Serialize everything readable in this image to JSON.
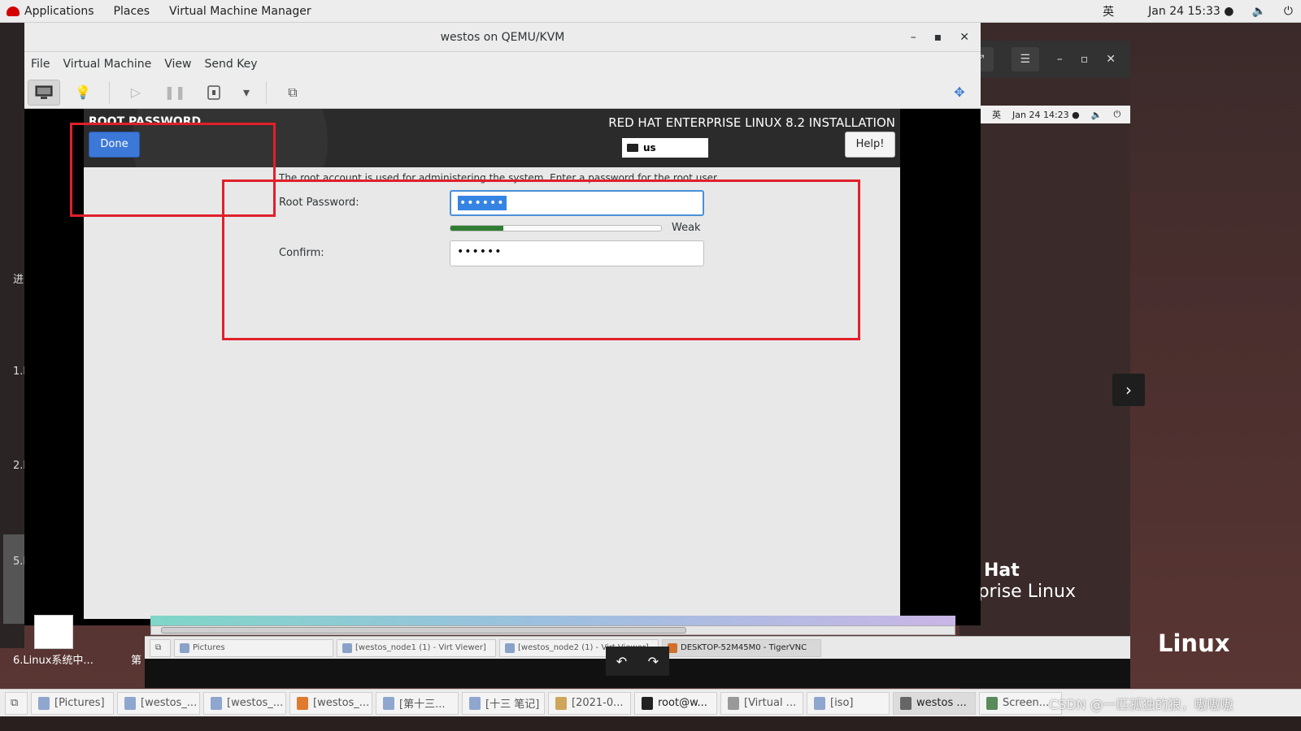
{
  "topbar": {
    "applications": "Applications",
    "places": "Places",
    "app_name": "Virtual Machine Manager",
    "input_method": "英",
    "datetime": "Jan 24  15:33 ●"
  },
  "vm_window": {
    "title": "westos on QEMU/KVM",
    "menu": [
      "File",
      "Virtual Machine",
      "View",
      "Send Key"
    ]
  },
  "installer": {
    "page_title": "ROOT PASSWORD",
    "done_label": "Done",
    "product_title": "RED HAT ENTERPRISE LINUX 8.2 INSTALLATION",
    "keyboard_layout": "us",
    "help_label": "Help!",
    "intro_text": "The root account is used for administering the system.  Enter a password for the root user.",
    "root_password_label": "Root Password:",
    "root_password_value": "••••••",
    "strength_label": "Weak",
    "strength_fraction": 0.25,
    "confirm_label": "Confirm:",
    "confirm_value": "••••••"
  },
  "annotation_color": "#e0202a",
  "background_window": {
    "inner_ime": "英",
    "inner_datetime": "Jan 24  14:23 ●",
    "logo_line1": "Hat",
    "logo_line2": "erprise Linux",
    "linux_text": "Linux"
  },
  "left_strip_labels": [
    "进",
    "1.l",
    "2.l",
    "5.l"
  ],
  "inner_taskbar": [
    "Pictures",
    "[westos_node1 (1) - Virt Viewer]",
    "[westos_node2 (1) - Virt Viewer]",
    "DESKTOP-52M45M0 - TigerVNC"
  ],
  "desktop": {
    "file_label": "6.Linux系统中...",
    "file_label2": "第"
  },
  "taskbar": [
    "[Pictures]",
    "[westos_...",
    "[westos_...",
    "[westos_...",
    "[第十三...",
    "[十三 笔记]",
    "[2021-0...",
    "root@w...",
    "[Virtual ...",
    "[iso]",
    "westos ...",
    "Screen..."
  ],
  "watermark": "CSDN @一匹孤独的狼，嗷嗷嗷"
}
